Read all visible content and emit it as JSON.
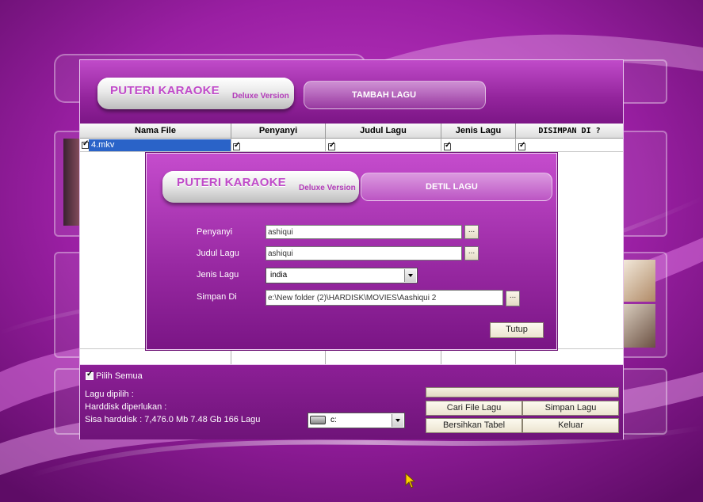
{
  "colors": {
    "accent": "#c04bc9",
    "header_bg": "#93249c",
    "selection": "#2a63c8"
  },
  "app": {
    "brand": "PUTERI KARAOKE",
    "edition": "Deluxe Version",
    "window_title": "TAMBAH LAGU"
  },
  "table": {
    "columns": [
      "Nama File",
      "Penyanyi",
      "Judul Lagu",
      "Jenis Lagu",
      "DISIMPAN DI ?"
    ],
    "rows": [
      {
        "file": "4.mkv",
        "checked": true
      }
    ]
  },
  "bottom": {
    "select_all": "Pilih Semua",
    "selected_label": "Lagu dipilih :",
    "disk_needed_label": "Harddisk diperlukan :",
    "disk_remaining": "Sisa harddisk : 7,476.0 Mb 7.48 Gb 166 Lagu",
    "drive_value": "c:",
    "drive_icon": "hard-drive-icon",
    "buttons": {
      "find": "Cari File Lagu",
      "save": "Simpan Lagu",
      "clear": "Bersihkan Tabel",
      "exit": "Keluar"
    }
  },
  "dialog": {
    "brand": "PUTERI KARAOKE",
    "edition": "Deluxe Version",
    "title": "DETIL LAGU",
    "fields": {
      "singer_label": "Penyanyi",
      "singer_value": "ashiqui",
      "title_label": "Judul Lagu",
      "title_value": "ashiqui",
      "genre_label": "Jenis Lagu",
      "genre_value": "india",
      "save_label": "Simpan Di",
      "save_value": "e:\\New folder (2)\\HARDISK\\MOVIES\\Aashiqui 2"
    },
    "browse": "...",
    "close": "Tutup"
  }
}
